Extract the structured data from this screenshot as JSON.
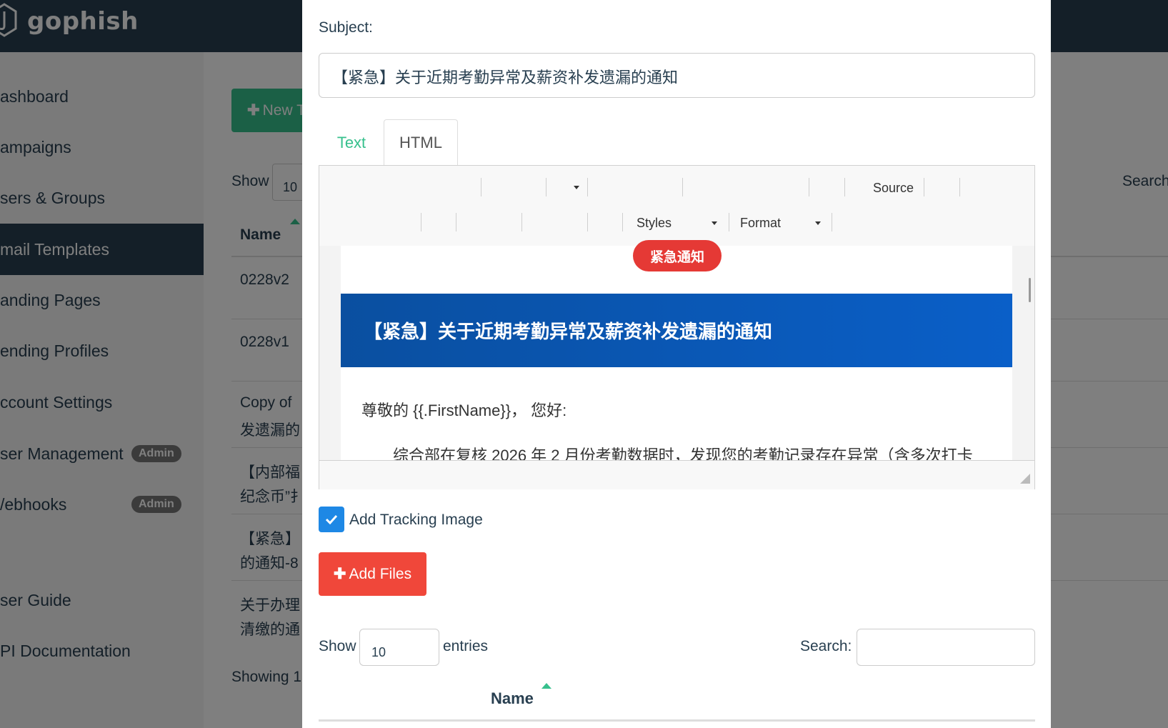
{
  "navbar": {
    "brand": "gophish"
  },
  "sidebar": {
    "items": [
      {
        "label": "ashboard"
      },
      {
        "label": "ampaigns"
      },
      {
        "label": "sers & Groups"
      },
      {
        "label": "mail Templates"
      },
      {
        "label": "anding Pages"
      },
      {
        "label": "ending Profiles"
      },
      {
        "label": "ccount Settings"
      },
      {
        "label": "ser Management",
        "badge": "Admin"
      },
      {
        "label": "/ebhooks",
        "badge": "Admin"
      },
      {
        "label": "ser Guide"
      },
      {
        "label": "PI Documentation"
      }
    ],
    "active_index": 3
  },
  "main": {
    "new_button": "New T",
    "show_label": "Show",
    "show_value": "10",
    "search_label": "Search",
    "name_header": "Name",
    "rows": [
      {
        "line1": "0228v2",
        "line2": ""
      },
      {
        "line1": "0228v1",
        "line2": ""
      },
      {
        "line1": "Copy of",
        "line2": "发遗漏的"
      },
      {
        "line1": "【内部福",
        "line2": "纪念币”扌"
      },
      {
        "line1": "【紧急】",
        "line2": "的通知-8"
      },
      {
        "line1": "关于办理",
        "line2": "清缴的通"
      }
    ],
    "showing": "Showing 1"
  },
  "modal": {
    "subject_label": "Subject:",
    "subject_value": "【紧急】关于近期考勤异常及薪资补发遗漏的通知",
    "tabs": [
      {
        "label": "Text"
      },
      {
        "label": "HTML"
      }
    ],
    "active_tab": "HTML",
    "toolbar": {
      "source": "Source",
      "styles": "Styles",
      "format": "Format"
    },
    "preview": {
      "pill": "紧急通知",
      "banner_title": "【紧急】关于近期考勤异常及薪资补发遗漏的通知",
      "greeting": "尊敬的 {{.FirstName}}， 您好:",
      "paragraph": "综合部在复核 2026 年 2 月份考勤数据时，发现您的考勤记录存在异常（含多次打卡"
    },
    "tracking": {
      "label": "Add Tracking Image",
      "checked": true
    },
    "add_files": "Add Files",
    "attachments": {
      "show_label": "Show",
      "show_value": "10",
      "entries_label": "entries",
      "search_label": "Search:",
      "search_value": "",
      "name_header": "Name"
    }
  },
  "colors": {
    "navbar": "#283f50",
    "accent_green": "#37c08d",
    "danger": "#f0473a",
    "banner_blue": "#0a5fc8",
    "checkbox_blue": "#1e88e5"
  }
}
